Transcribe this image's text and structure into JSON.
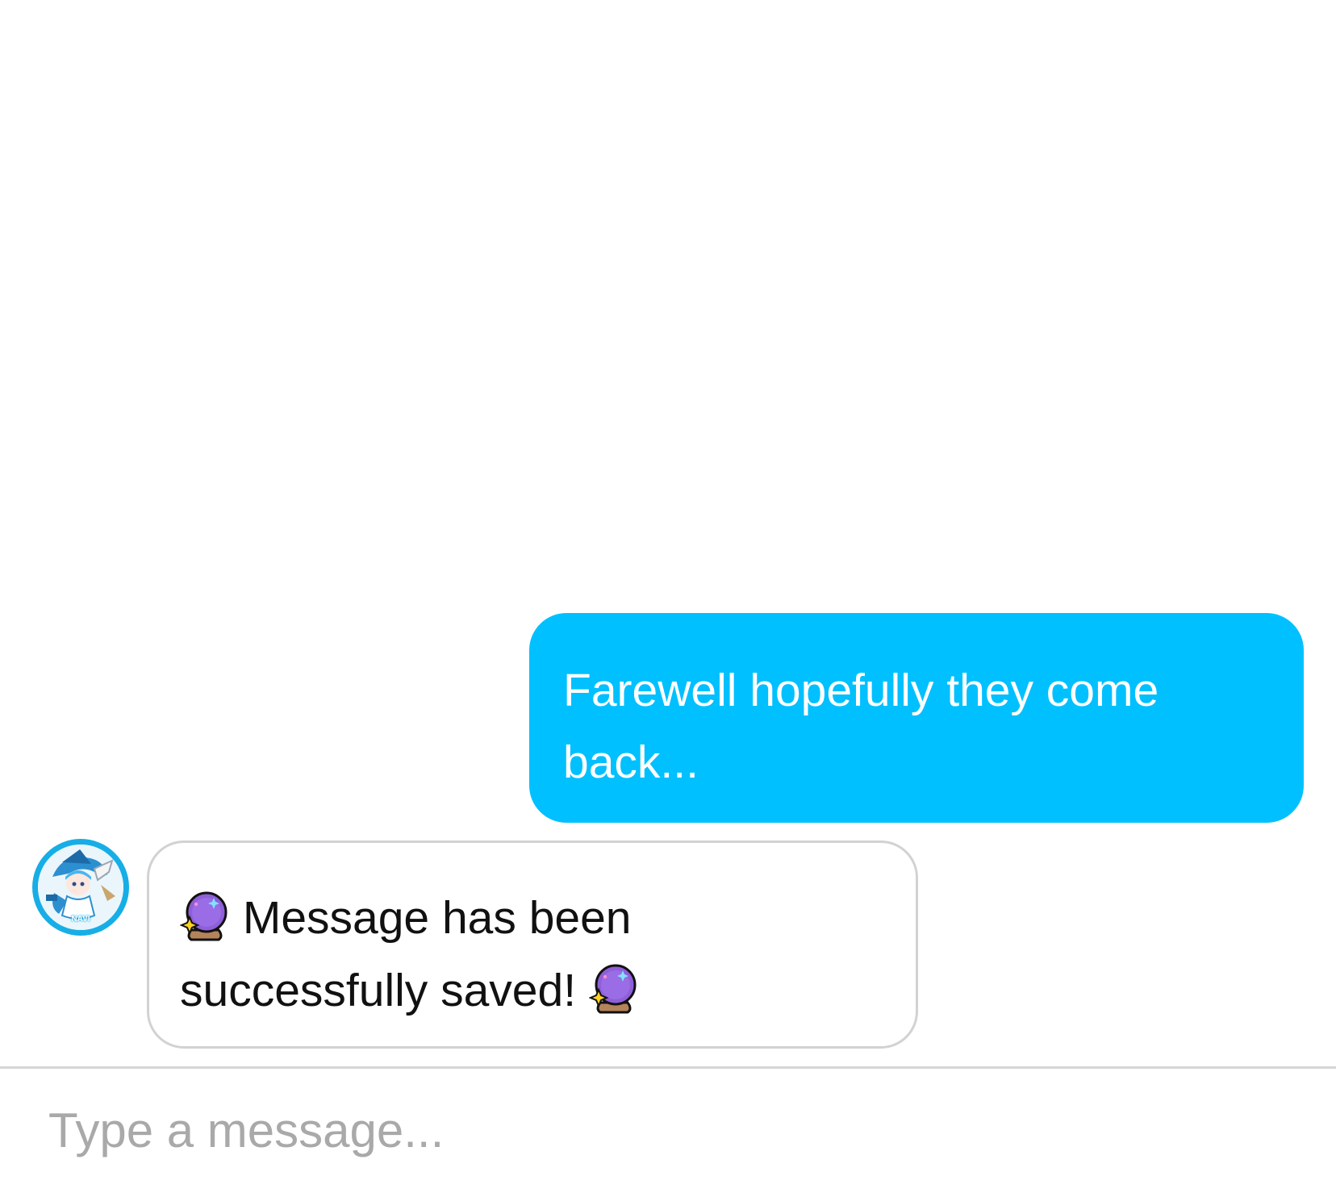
{
  "conversation": {
    "messages": [
      {
        "direction": "outgoing",
        "text": "Farewell hopefully they come back..."
      },
      {
        "direction": "incoming",
        "avatar_icon": "navi-avatar-icon",
        "avatar_label": "NAVI",
        "text": "Message has been successfully saved!",
        "leading_icon": "crystal-ball-icon",
        "trailing_icon": "crystal-ball-icon"
      }
    ]
  },
  "composer": {
    "placeholder": "Type a message..."
  },
  "colors": {
    "outgoing_bubble": "#00c0ff",
    "incoming_border": "#d2d2d2",
    "avatar_ring": "#17aee6",
    "placeholder": "#a9a9a9"
  }
}
